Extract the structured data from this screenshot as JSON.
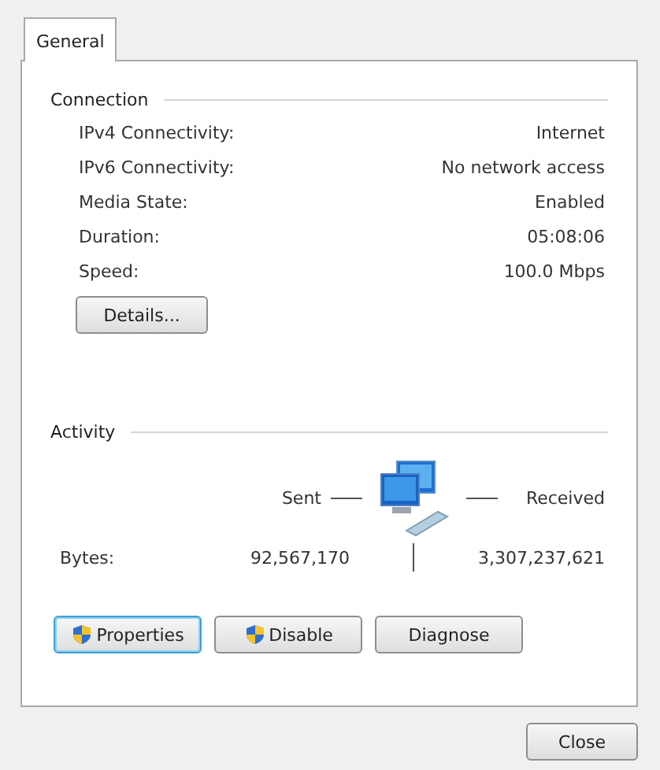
{
  "tabs": [
    {
      "label": "General",
      "selected": true
    }
  ],
  "connection": {
    "heading": "Connection",
    "rows": [
      {
        "label": "IPv4 Connectivity:",
        "value": "Internet"
      },
      {
        "label": "IPv6 Connectivity:",
        "value": "No network access"
      },
      {
        "label": "Media State:",
        "value": "Enabled"
      },
      {
        "label": "Duration:",
        "value": "05:08:06"
      },
      {
        "label": "Speed:",
        "value": "100.0 Mbps"
      }
    ],
    "details_button": "Details..."
  },
  "activity": {
    "heading": "Activity",
    "sent_label": "Sent",
    "received_label": "Received",
    "bytes_label": "Bytes:",
    "bytes_sent": "92,567,170",
    "bytes_received": "3,307,237,621"
  },
  "actions": [
    {
      "label": "Properties",
      "shield": true,
      "focused": true
    },
    {
      "label": "Disable",
      "shield": true,
      "focused": false
    },
    {
      "label": "Diagnose",
      "shield": false,
      "focused": false
    }
  ],
  "close_button": "Close"
}
